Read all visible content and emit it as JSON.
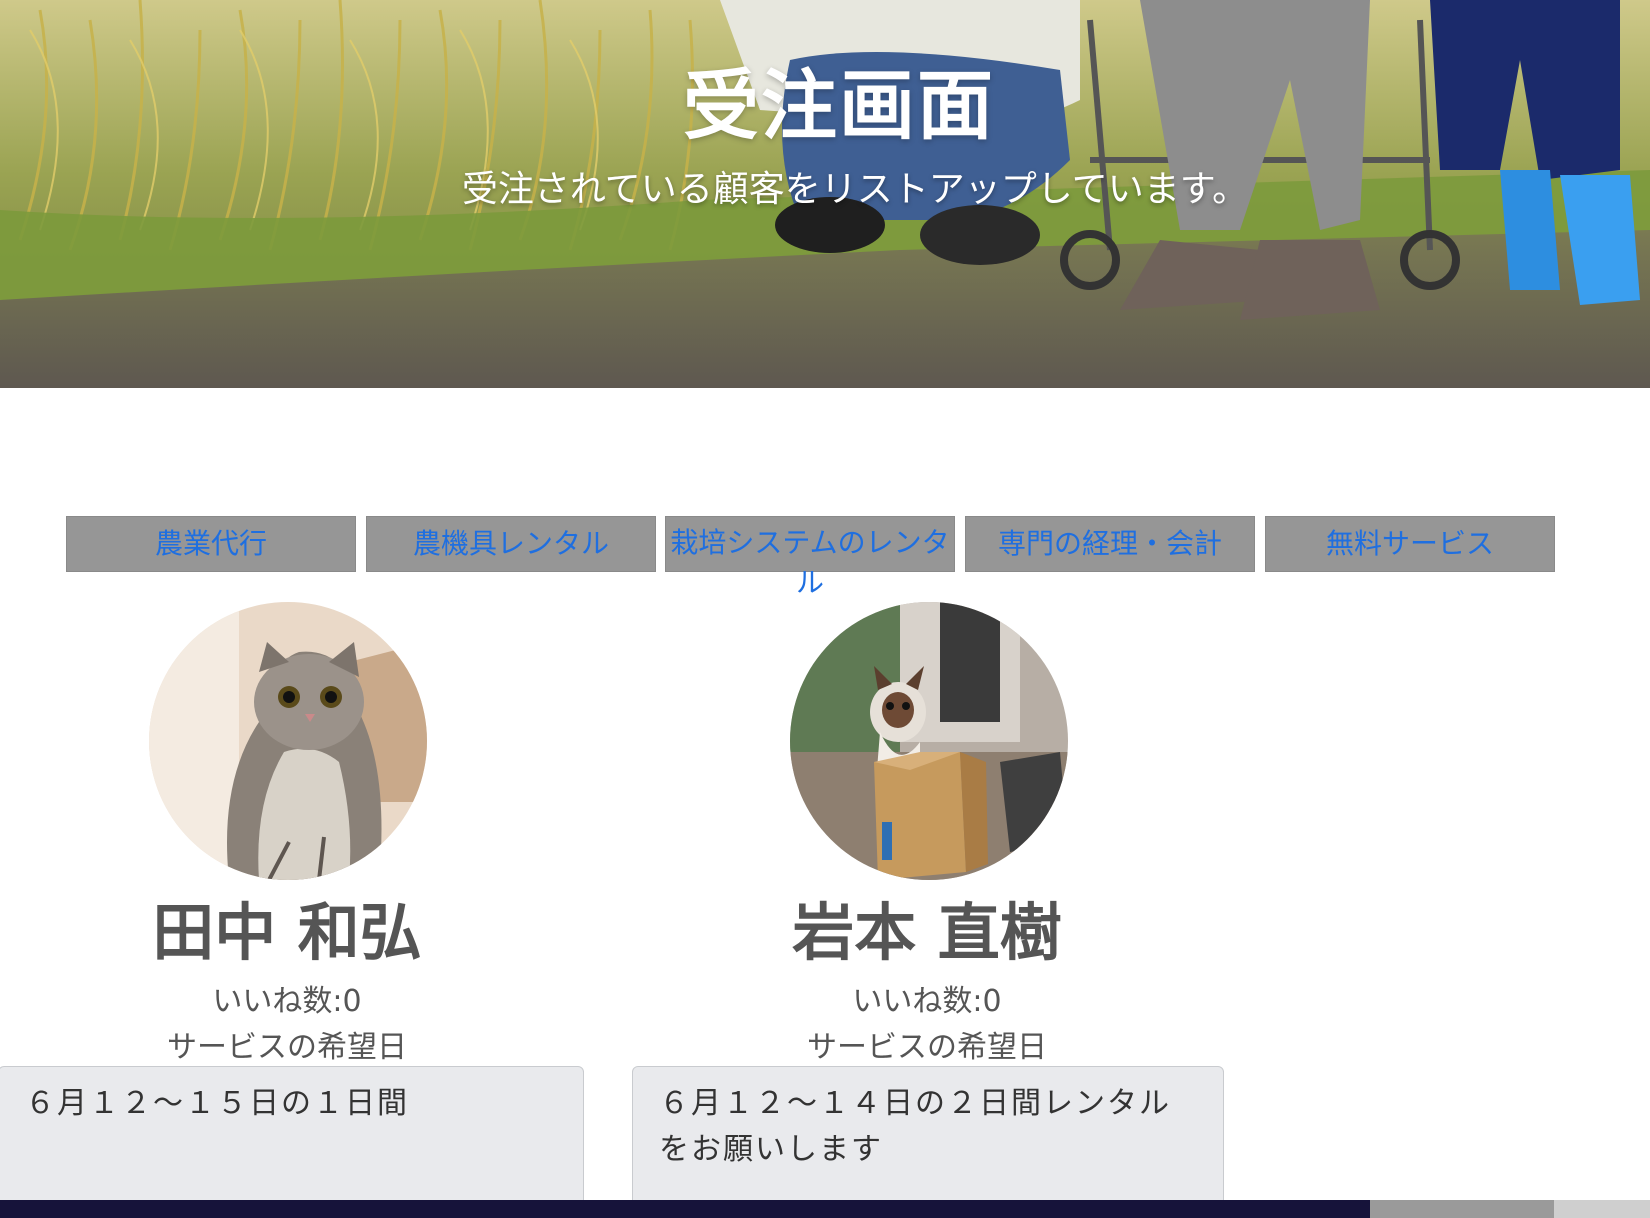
{
  "hero": {
    "title": "受注画面",
    "subtitle": "受注されている顧客をリストアップしています。",
    "background_image": "rice-field-family-photo"
  },
  "nav": {
    "items": [
      {
        "label": "農業代行"
      },
      {
        "label": "農機具レンタル"
      },
      {
        "label_line1": "栽培システムのレンタ",
        "label_line2": "ル"
      },
      {
        "label": "専門の経理・会計"
      },
      {
        "label": "無料サービス"
      }
    ],
    "colors": {
      "background": "#969696",
      "link": "#1f6fe0"
    }
  },
  "customers": [
    {
      "avatar": "scottish-fold-cat-photo",
      "name": "田中 和弘",
      "likes": "いいね数:0",
      "date_label": "サービスの希望日",
      "request": "６月１２〜１５日の１日間"
    },
    {
      "avatar": "cat-in-box-photo",
      "name": "岩本 直樹",
      "likes": "いいね数:0",
      "date_label": "サービスの希望日",
      "request": "６月１２〜１４日の２日間レンタルをお願いします"
    }
  ]
}
